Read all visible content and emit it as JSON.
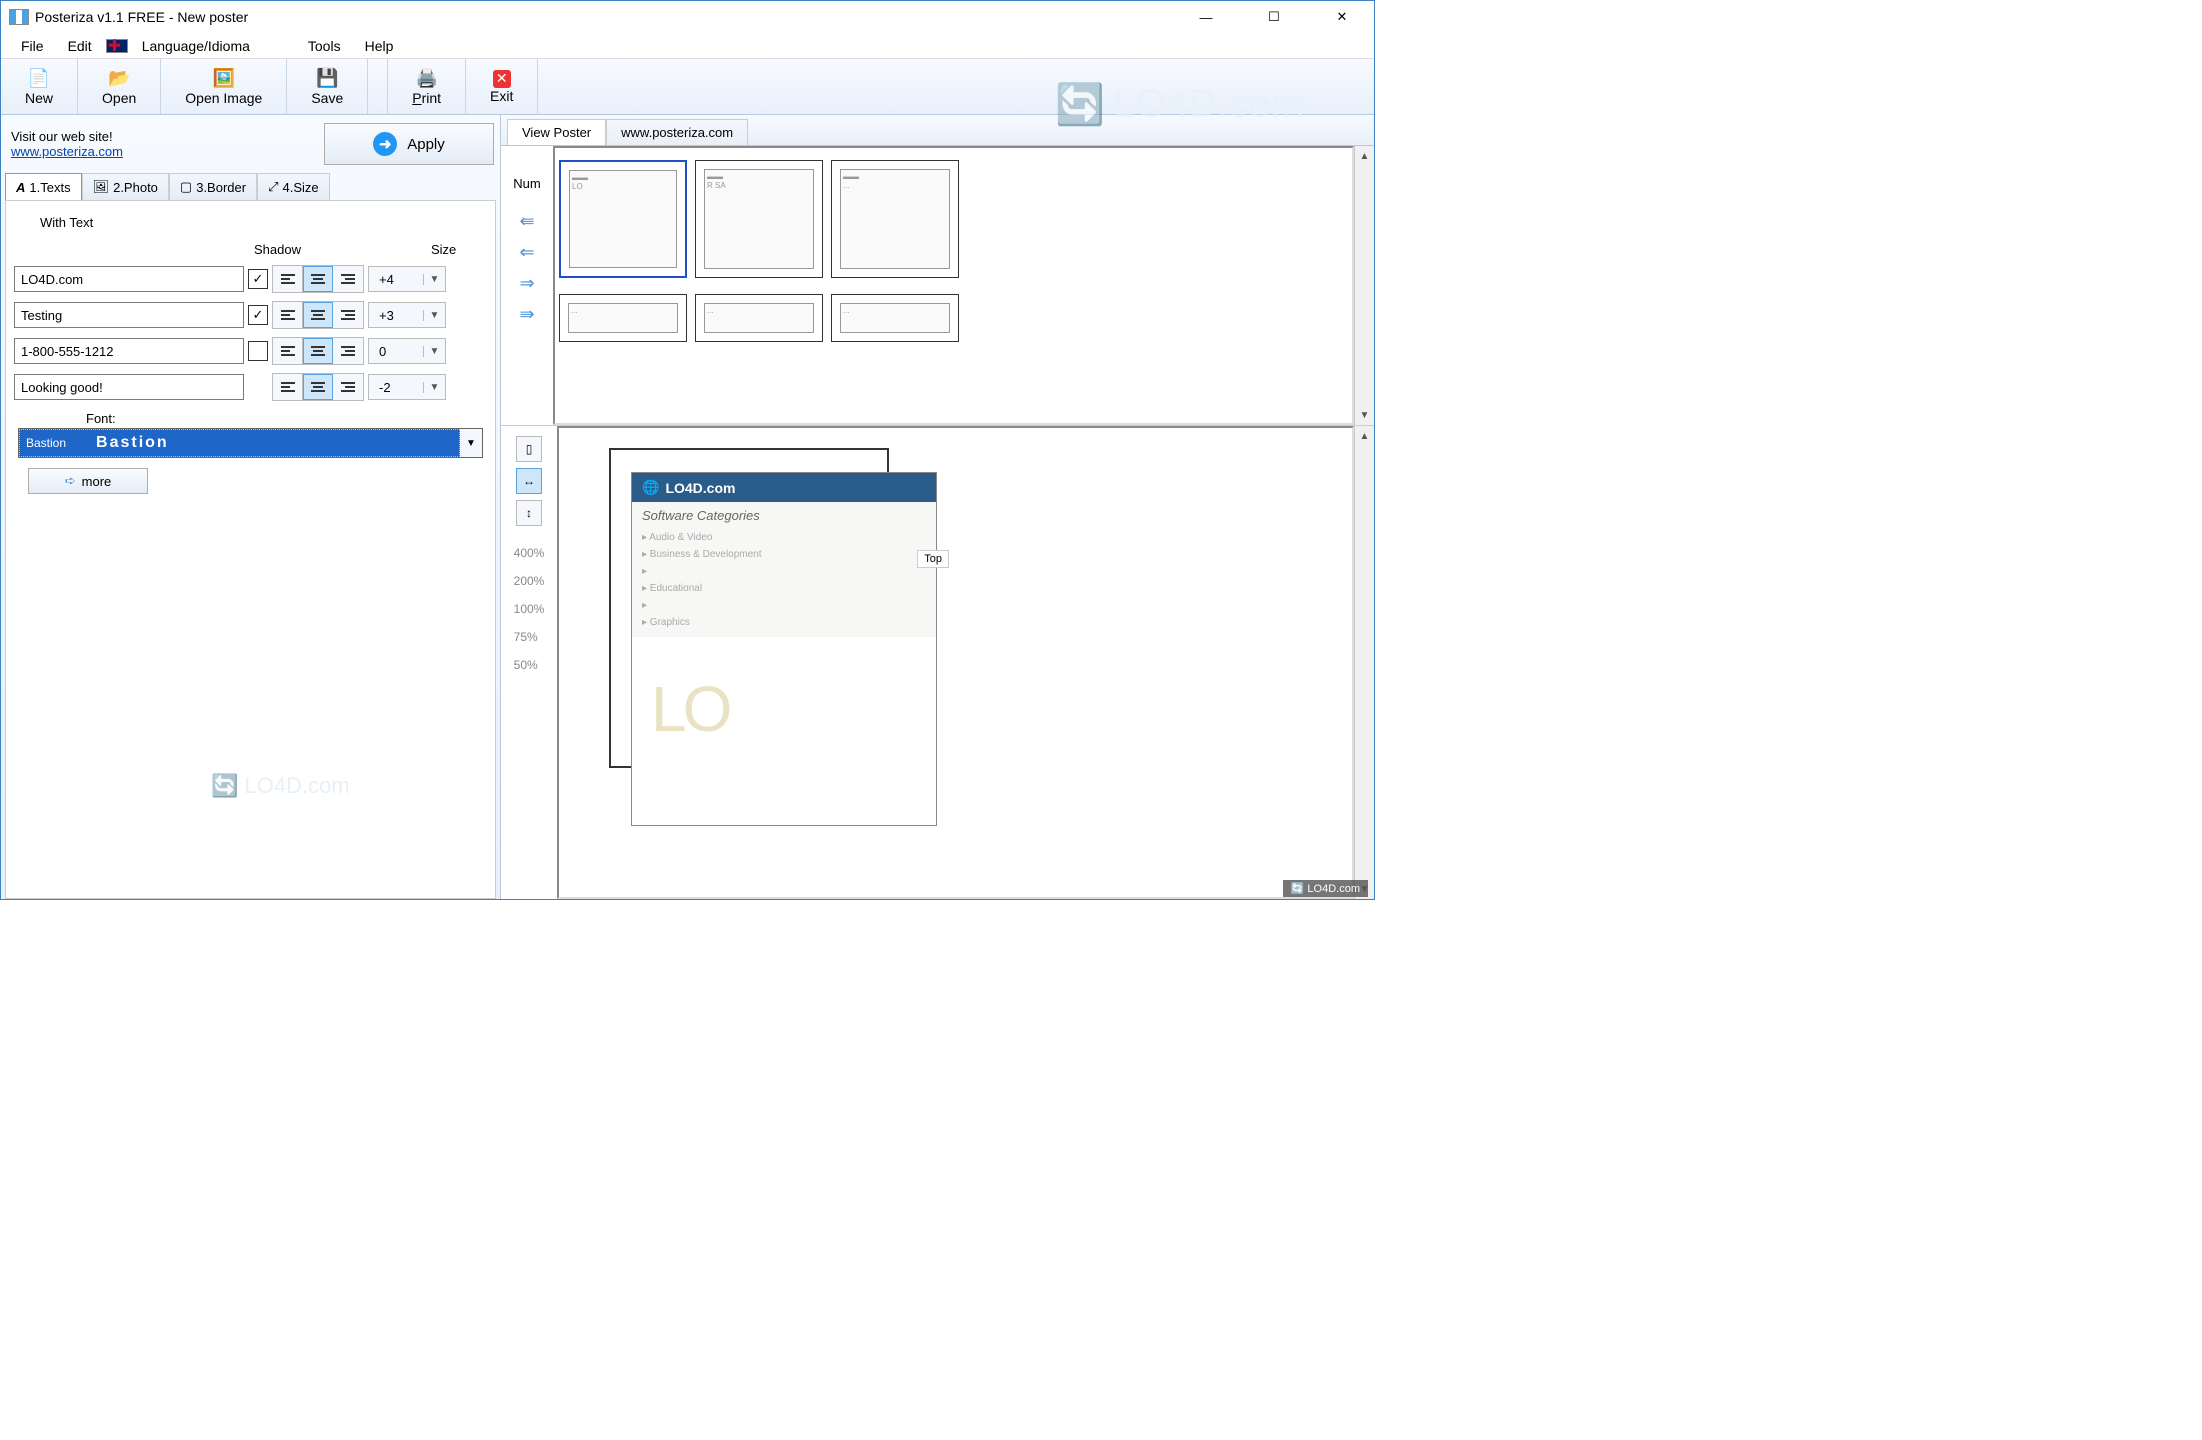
{
  "window": {
    "title": "Posteriza v1.1 FREE - New poster"
  },
  "menu": {
    "file": "File",
    "edit": "Edit",
    "language": "Language/Idioma",
    "tools": "Tools",
    "help": "Help"
  },
  "toolbar": {
    "new": "New",
    "open": "Open",
    "open_image": "Open Image",
    "save": "Save",
    "print": "Print",
    "exit": "Exit"
  },
  "left": {
    "visit": "Visit our web site!",
    "url": "www.posteriza.com",
    "apply": "Apply",
    "tabs": {
      "t1": "1.Texts",
      "t2": "2.Photo",
      "t3": "3.Border",
      "t4": "4.Size"
    },
    "with_text": "With Text",
    "shadow_header": "Shadow",
    "size_header": "Size",
    "rows": [
      {
        "text": "LO4D.com",
        "shadow": true,
        "align": "center",
        "size": "+4"
      },
      {
        "text": "Testing",
        "shadow": true,
        "align": "center",
        "size": "+3"
      },
      {
        "text": "1-800-555-1212",
        "shadow": false,
        "align": "center",
        "size": "0"
      },
      {
        "text": "Looking good!",
        "shadow": null,
        "align": "center",
        "size": "-2"
      }
    ],
    "font_label": "Font:",
    "font_name": "Bastion",
    "font_preview": "Bastion",
    "more": "more"
  },
  "right": {
    "view_tab": "View Poster",
    "web_tab": "www.posteriza.com",
    "num": "Num",
    "zoom_levels": [
      "400%",
      "200%",
      "100%",
      "75%",
      "50%"
    ],
    "lo4d": "LO4D.com",
    "cat_title": "Software Categories",
    "cats": [
      "Audio & Video",
      "Business & Development",
      "",
      "Educational",
      "",
      "Graphics"
    ],
    "top_tab": "Top"
  },
  "watermark": "LO4D.com"
}
